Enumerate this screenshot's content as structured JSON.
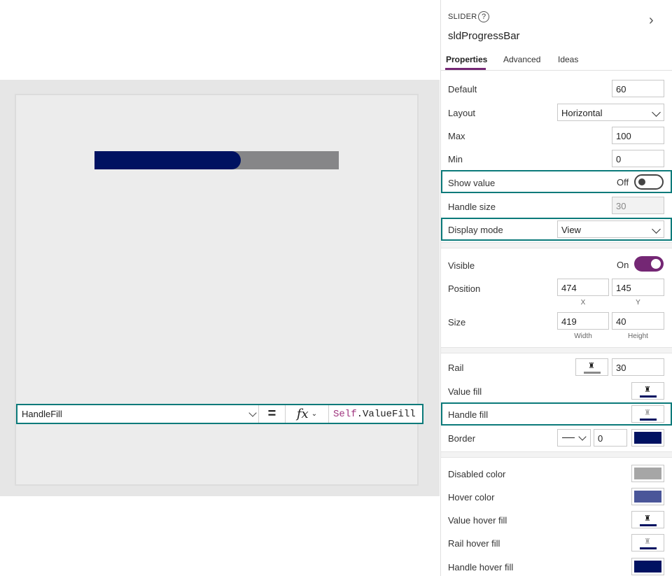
{
  "canvas": {
    "slider": {
      "value": 60,
      "min": 0,
      "max": 100,
      "value_fill_color": "#001261",
      "rail_color": "#868688"
    }
  },
  "formula_bar": {
    "property": "HandleFill",
    "equals": "=",
    "fx": "fx",
    "formula_keyword": "Self",
    "formula_rest": ".ValueFill"
  },
  "panel": {
    "control_type": "SLIDER",
    "control_name": "sldProgressBar",
    "tabs": [
      "Properties",
      "Advanced",
      "Ideas"
    ],
    "active_tab": "Properties",
    "accent_color": "#742774",
    "highlight_color": "#0b7a7a",
    "props": {
      "default_label": "Default",
      "default_value": "60",
      "layout_label": "Layout",
      "layout_value": "Horizontal",
      "max_label": "Max",
      "max_value": "100",
      "min_label": "Min",
      "min_value": "0",
      "show_value_label": "Show value",
      "show_value_state": "Off",
      "handle_size_label": "Handle size",
      "handle_size_value": "30",
      "display_mode_label": "Display mode",
      "display_mode_value": "View",
      "visible_label": "Visible",
      "visible_state": "On",
      "position_label": "Position",
      "position_x": "474",
      "position_y": "145",
      "x_caption": "X",
      "y_caption": "Y",
      "size_label": "Size",
      "size_width": "419",
      "size_height": "40",
      "width_caption": "Width",
      "height_caption": "Height",
      "rail_label": "Rail",
      "rail_thickness": "30",
      "value_fill_label": "Value fill",
      "handle_fill_label": "Handle fill",
      "border_label": "Border",
      "border_thickness": "0",
      "disabled_color_label": "Disabled color",
      "hover_color_label": "Hover color",
      "value_hover_fill_label": "Value hover fill",
      "rail_hover_fill_label": "Rail hover fill",
      "handle_hover_fill_label": "Handle hover fill"
    },
    "colors": {
      "rail": "#8a8a8a",
      "value_fill": "#001261",
      "handle_fill": "#c8c8c8",
      "border": "#001261",
      "disabled": "#a6a6a6",
      "hover": "#4a5699",
      "value_hover_fill": "#001261",
      "rail_hover_fill": "#c8c8c8",
      "handle_hover_fill": "#001261"
    }
  }
}
